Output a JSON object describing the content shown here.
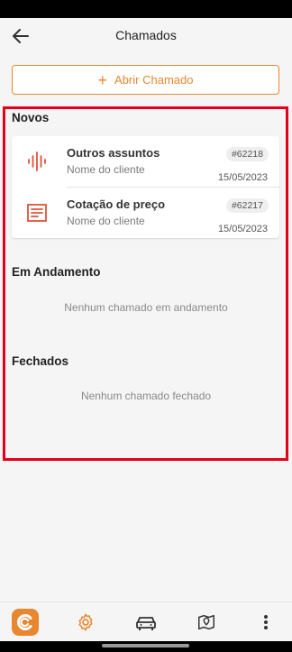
{
  "app_bar": {
    "title": "Chamados",
    "back_icon": "arrow-left-icon"
  },
  "open_button": {
    "label": "Abrir Chamado",
    "icon": "plus-icon",
    "accent_color": "#e8872f"
  },
  "sections": {
    "novos": {
      "title": "Novos",
      "items": [
        {
          "icon": "audio-wave-icon",
          "title": "Outros assuntos",
          "subtitle": "Nome do cliente",
          "id": "#62218",
          "date": "15/05/2023"
        },
        {
          "icon": "document-lines-icon",
          "title": "Cotação de preço",
          "subtitle": "Nome do cliente",
          "id": "#62217",
          "date": "15/05/2023"
        }
      ]
    },
    "em_andamento": {
      "title": "Em Andamento",
      "empty": "Nenhum chamado em andamento"
    },
    "fechados": {
      "title": "Fechados",
      "empty": "Nenhum chamado fechado"
    }
  },
  "bottom_nav": {
    "items": [
      "app-logo-icon",
      "settings-gear-icon",
      "car-icon",
      "map-pin-icon",
      "more-vertical-icon"
    ],
    "active": "settings-gear-icon"
  },
  "colors": {
    "accent": "#e8872f",
    "icon_red": "#e0533a",
    "highlight": "#e3001b"
  }
}
